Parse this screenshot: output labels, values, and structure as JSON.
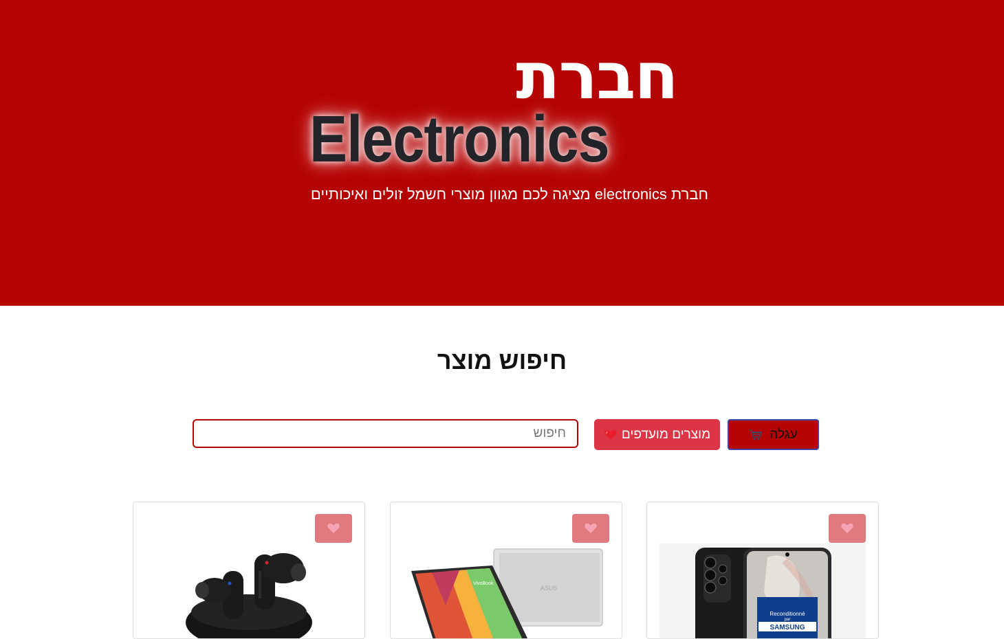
{
  "hero": {
    "title_hebrew": "חברת",
    "title_english": "Electronics",
    "subtitle": "חברת electronics מציגה לכם מגוון מוצרי חשמל זולים ואיכותיים",
    "background_color": "#b50202"
  },
  "search": {
    "heading": "חיפוש מוצר",
    "placeholder": "חיפוש",
    "value": ""
  },
  "actions": {
    "favorites_label": "מוצרים מועדפים",
    "favorites_icon": "heart-icon",
    "cart_label": "עגלה",
    "cart_icon": "cart-icon"
  },
  "products": [
    {
      "image": "samsung-galaxy-phone",
      "favorite_icon": "heart-icon"
    },
    {
      "image": "asus-vivobook-laptop",
      "favorite_icon": "heart-icon"
    },
    {
      "image": "wireless-earbuds",
      "favorite_icon": "heart-icon"
    }
  ],
  "colors": {
    "brand_red": "#b50202",
    "button_red": "#dc3545",
    "fav_toggle": "#e07a7e"
  }
}
